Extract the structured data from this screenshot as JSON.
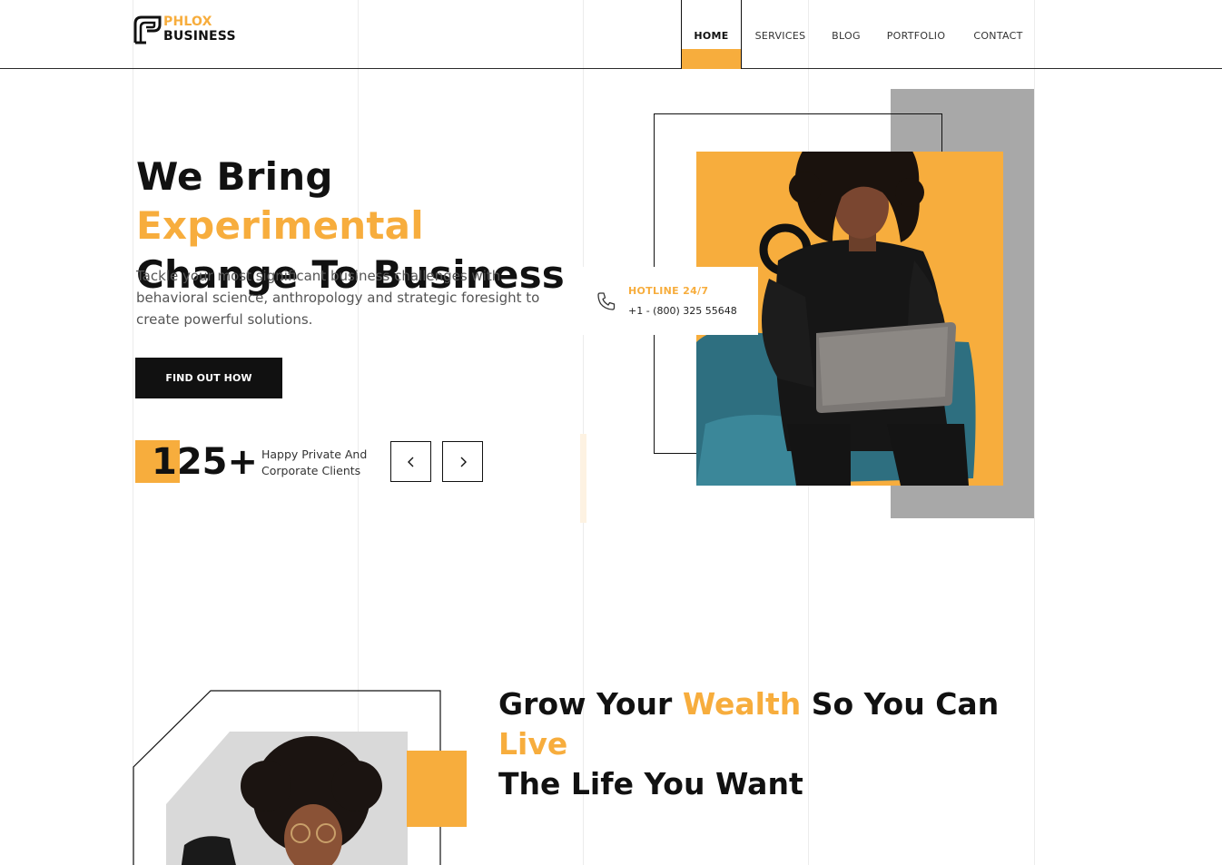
{
  "brand": {
    "top": "PHLOX",
    "bottom": "BUSINESS",
    "icon": "phlox-logo-icon"
  },
  "nav": {
    "home": "HOME",
    "services": "SERVICES",
    "blog": "BLOG",
    "portfolio": "PORTFOLIO",
    "contact": "CONTACT"
  },
  "hero": {
    "title_part1": "We Bring ",
    "title_accent": "Experimental",
    "title_part2": "Change To Business",
    "description": "Tackle your most significant business challenges with behavioral science, anthropology and strategic foresight to create powerful solutions.",
    "cta": "FIND OUT HOW",
    "count": "125+",
    "count_label": "Happy Private And Corporate Clients",
    "prev_icon": "chevron-left-icon",
    "next_icon": "chevron-right-icon"
  },
  "hotline": {
    "title": "HOTLINE 24/7",
    "number": "+1 - (800) 325 55648",
    "icon": "phone-icon"
  },
  "section2": {
    "title_part1": "Grow Your ",
    "title_accent1": "Wealth",
    "title_part2": " So You Can ",
    "title_accent2": "Live",
    "title_part3": "The Life You Want"
  },
  "colors": {
    "accent": "#f7ad3d",
    "dark": "#111111",
    "gray_block": "#a8a8a8"
  }
}
